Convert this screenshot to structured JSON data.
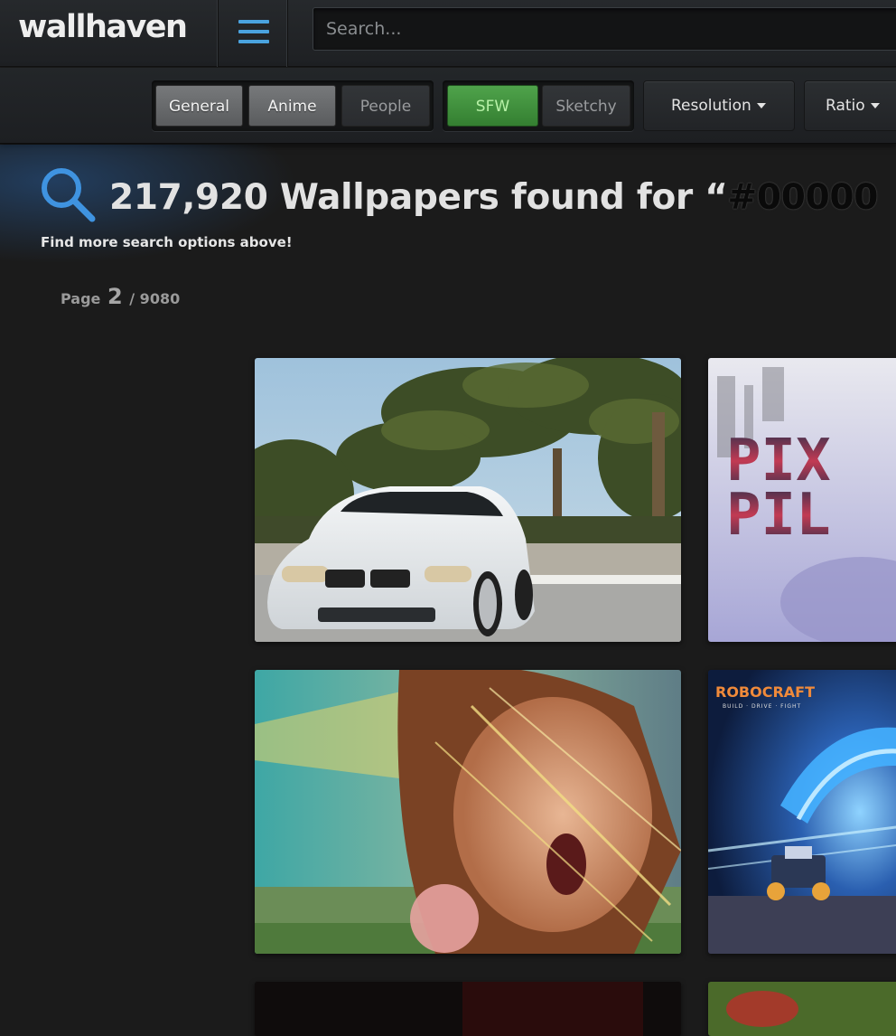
{
  "header": {
    "logo": "wallhaven",
    "search_placeholder": "Search...",
    "menu_icon": "hamburger-icon"
  },
  "filters": {
    "categories": [
      {
        "label": "General",
        "active": true
      },
      {
        "label": "Anime",
        "active": true
      },
      {
        "label": "People",
        "active": false
      }
    ],
    "purity": [
      {
        "label": "SFW",
        "active": true
      },
      {
        "label": "Sketchy",
        "active": false
      }
    ],
    "dropdowns": [
      {
        "label": "Resolution"
      },
      {
        "label": "Ratio"
      }
    ]
  },
  "results": {
    "count": "217,920",
    "title_text": "Wallpapers found for “",
    "query": "#00000",
    "hint": "Find more search options above!",
    "page_label": "Page",
    "page_current": "2",
    "page_total": "/ 9080"
  },
  "thumbnails": [
    {
      "subject": "white-car-palm-trees"
    },
    {
      "subject": "pixel-game-title"
    },
    {
      "subject": "girl-face-abstract"
    },
    {
      "subject": "robocraft-game"
    },
    {
      "subject": "dark-partial"
    },
    {
      "subject": "green-partial"
    }
  ],
  "thumbnail_text": {
    "pixel_line1": "PIX",
    "pixel_line2": "PIL",
    "robocraft_logo": "ROBOCRAFT",
    "robocraft_tagline": "BUILD · DRIVE · FIGHT"
  },
  "colors": {
    "accent": "#4aa3df",
    "sfw": "#3f9a3b",
    "background": "#1b1b1b"
  }
}
